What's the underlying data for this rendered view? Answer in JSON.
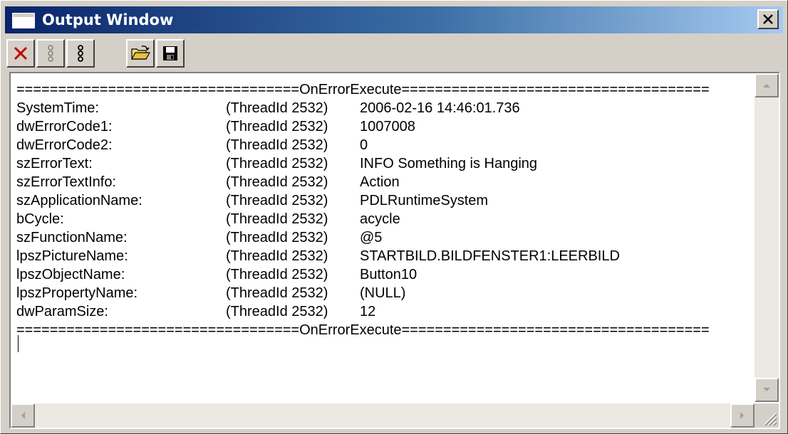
{
  "window": {
    "title": "Output Window"
  },
  "toolbar": {
    "buttons": [
      {
        "icon": "delete-icon"
      },
      {
        "icon": "thread-grey-icon"
      },
      {
        "icon": "thread-black-icon"
      },
      {
        "icon": "open-folder-icon"
      },
      {
        "icon": "save-icon"
      }
    ]
  },
  "output": {
    "header": "==================================OnErrorExecute=====================================",
    "footer": "==================================OnErrorExecute=====================================",
    "rows": [
      {
        "field": "SystemTime:",
        "thread": "(ThreadId 2532)",
        "value": "2006-02-16 14:46:01.736"
      },
      {
        "field": "dwErrorCode1:",
        "thread": "(ThreadId 2532)",
        "value": "1007008"
      },
      {
        "field": "dwErrorCode2:",
        "thread": "(ThreadId 2532)",
        "value": "0"
      },
      {
        "field": "szErrorText:",
        "thread": "(ThreadId 2532)",
        "value": "INFO Something is Hanging"
      },
      {
        "field": "szErrorTextInfo:",
        "thread": "(ThreadId 2532)",
        "value": "Action"
      },
      {
        "field": "szApplicationName:",
        "thread": "(ThreadId 2532)",
        "value": "PDLRuntimeSystem"
      },
      {
        "field": "bCycle:",
        "thread": "(ThreadId 2532)",
        "value": "acycle"
      },
      {
        "field": "szFunctionName:",
        "thread": "(ThreadId 2532)",
        "value": "@5"
      },
      {
        "field": "lpszPictureName:",
        "thread": "(ThreadId 2532)",
        "value": "STARTBILD.BILDFENSTER1:LEERBILD"
      },
      {
        "field": "lpszObjectName:",
        "thread": "(ThreadId 2532)",
        "value": "Button10"
      },
      {
        "field": "lpszPropertyName:",
        "thread": "(ThreadId 2532)",
        "value": "(NULL)"
      },
      {
        "field": "dwParamSize:",
        "thread": "(ThreadId 2532)",
        "value": "12"
      }
    ]
  }
}
